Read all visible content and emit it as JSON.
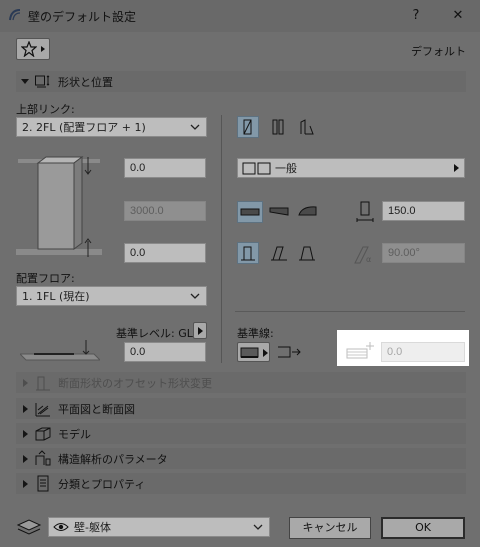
{
  "window": {
    "title": "壁のデフォルト設定",
    "help": "?",
    "close": "✕"
  },
  "header": {
    "favorites_icon": "star-icon",
    "default_label": "デフォルト"
  },
  "sections": {
    "geometry": "形状と位置",
    "offset": "断面形状のオフセット形状変更",
    "floor_plan": "平面図と断面図",
    "model": "モデル",
    "structural": "構造解析のパラメータ",
    "classification": "分類とプロパティ"
  },
  "geometry": {
    "top_link_label": "上部リンク:",
    "top_link_value": "2. 2FL (配置フロア + 1)",
    "top_offset": "0.0",
    "height": "3000.0",
    "bottom_offset": "0.0",
    "home_story_label": "配置フロア:",
    "home_story_value": "1. 1FL (現在)",
    "ref_level_label": "基準レベル: GL",
    "ref_level_value": "0.0",
    "structure_value": "一般",
    "thickness": "150.0",
    "slant_angle": "90.00°",
    "ref_line_label": "基準線:",
    "ref_line_offset": "0.0"
  },
  "footer": {
    "layer_value": "壁-躯体",
    "cancel_label": "キャンセル",
    "ok_label": "OK"
  },
  "colors": {
    "selected_bg": "#8298a8",
    "highlight": "#ffffff"
  }
}
